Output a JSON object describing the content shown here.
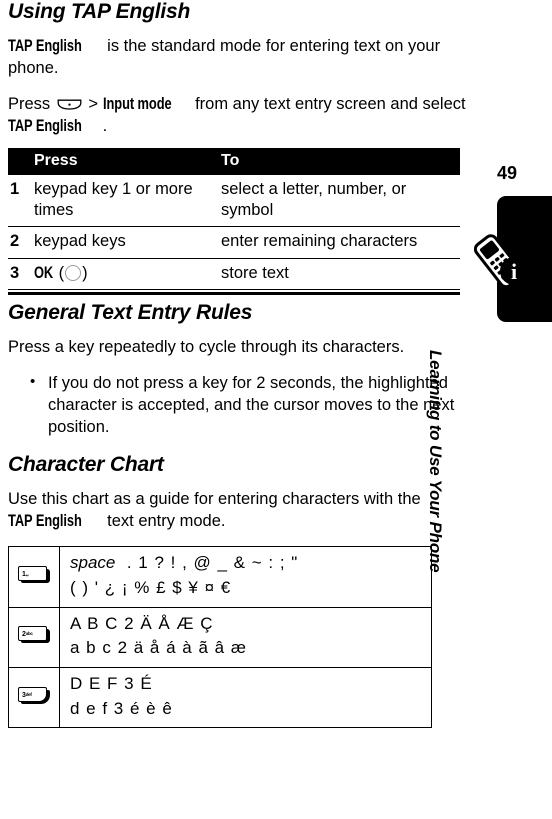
{
  "page": {
    "number": "49",
    "chapter_label": "Learning to Use Your Phone"
  },
  "sections": {
    "using_tap": {
      "title": "Using TAP English",
      "intro_bold": "TAP English",
      "intro_rest": " is the standard mode for entering text on your phone.",
      "press_pre": "Press ",
      "press_menu_icon": "menu-key-icon",
      "press_sep": " > ",
      "press_bold": "Input mode",
      "press_mid": " from any text entry screen and select ",
      "press_bold2": "TAP English",
      "press_end": "."
    },
    "general_rules": {
      "title": "General Text Entry Rules",
      "paragraph": "Press a key repeatedly to cycle through its characters.",
      "bullets": [
        "If you do not press a key for 2 seconds, the highlighted character is accepted, and the cursor moves to the next position."
      ]
    },
    "character_chart": {
      "title": "Character Chart",
      "intro_pre": "Use this chart as a guide for entering characters with the ",
      "intro_bold": "TAP English",
      "intro_post": " text entry mode."
    }
  },
  "procedure_table": {
    "headers": [
      "",
      "Press",
      "To"
    ],
    "rows": [
      {
        "num": "1",
        "press": "keypad key 1 or more times",
        "to": "select a letter, number, or symbol"
      },
      {
        "num": "2",
        "press": "keypad keys",
        "to": "enter remaining characters"
      },
      {
        "num": "3",
        "press_bold": "OK",
        "press_paren_open": "(",
        "press_paren_close": ")",
        "press_icon": "center-select-circle-icon",
        "to": "store text"
      }
    ]
  },
  "character_chart_rows": [
    {
      "key_label": "1",
      "key_sub": "␣",
      "key_icon": "keypad-key-1-icon",
      "upper_line": "space  .  1  ?  !  ,  @  _  &  ~  :  ;  \"",
      "lower_line": "(  )  '  ¿  ¡  %  £  $  ¥  ¤  €",
      "first_word_italic": "space",
      "upper_rest": ".  1  ?  !  ,  @  _  &  ~  :  ;  \""
    },
    {
      "key_label": "2",
      "key_sub": "abc",
      "key_icon": "keypad-key-2-icon",
      "upper_line": "A  B  C  2  Ä  Å  Æ  Ç",
      "lower_line": "a  b  c  2  ä  å  á  à  ã  â  æ"
    },
    {
      "key_label": "3",
      "key_sub": "def",
      "key_icon": "keypad-key-3-icon",
      "upper_line": "D  E  F  3  É",
      "lower_line": "d  e  f  3  é  è  ê"
    }
  ],
  "colors": {
    "text": "#000000",
    "header_bg": "#000000",
    "header_text": "#ffffff",
    "page_bg": "#ffffff"
  }
}
